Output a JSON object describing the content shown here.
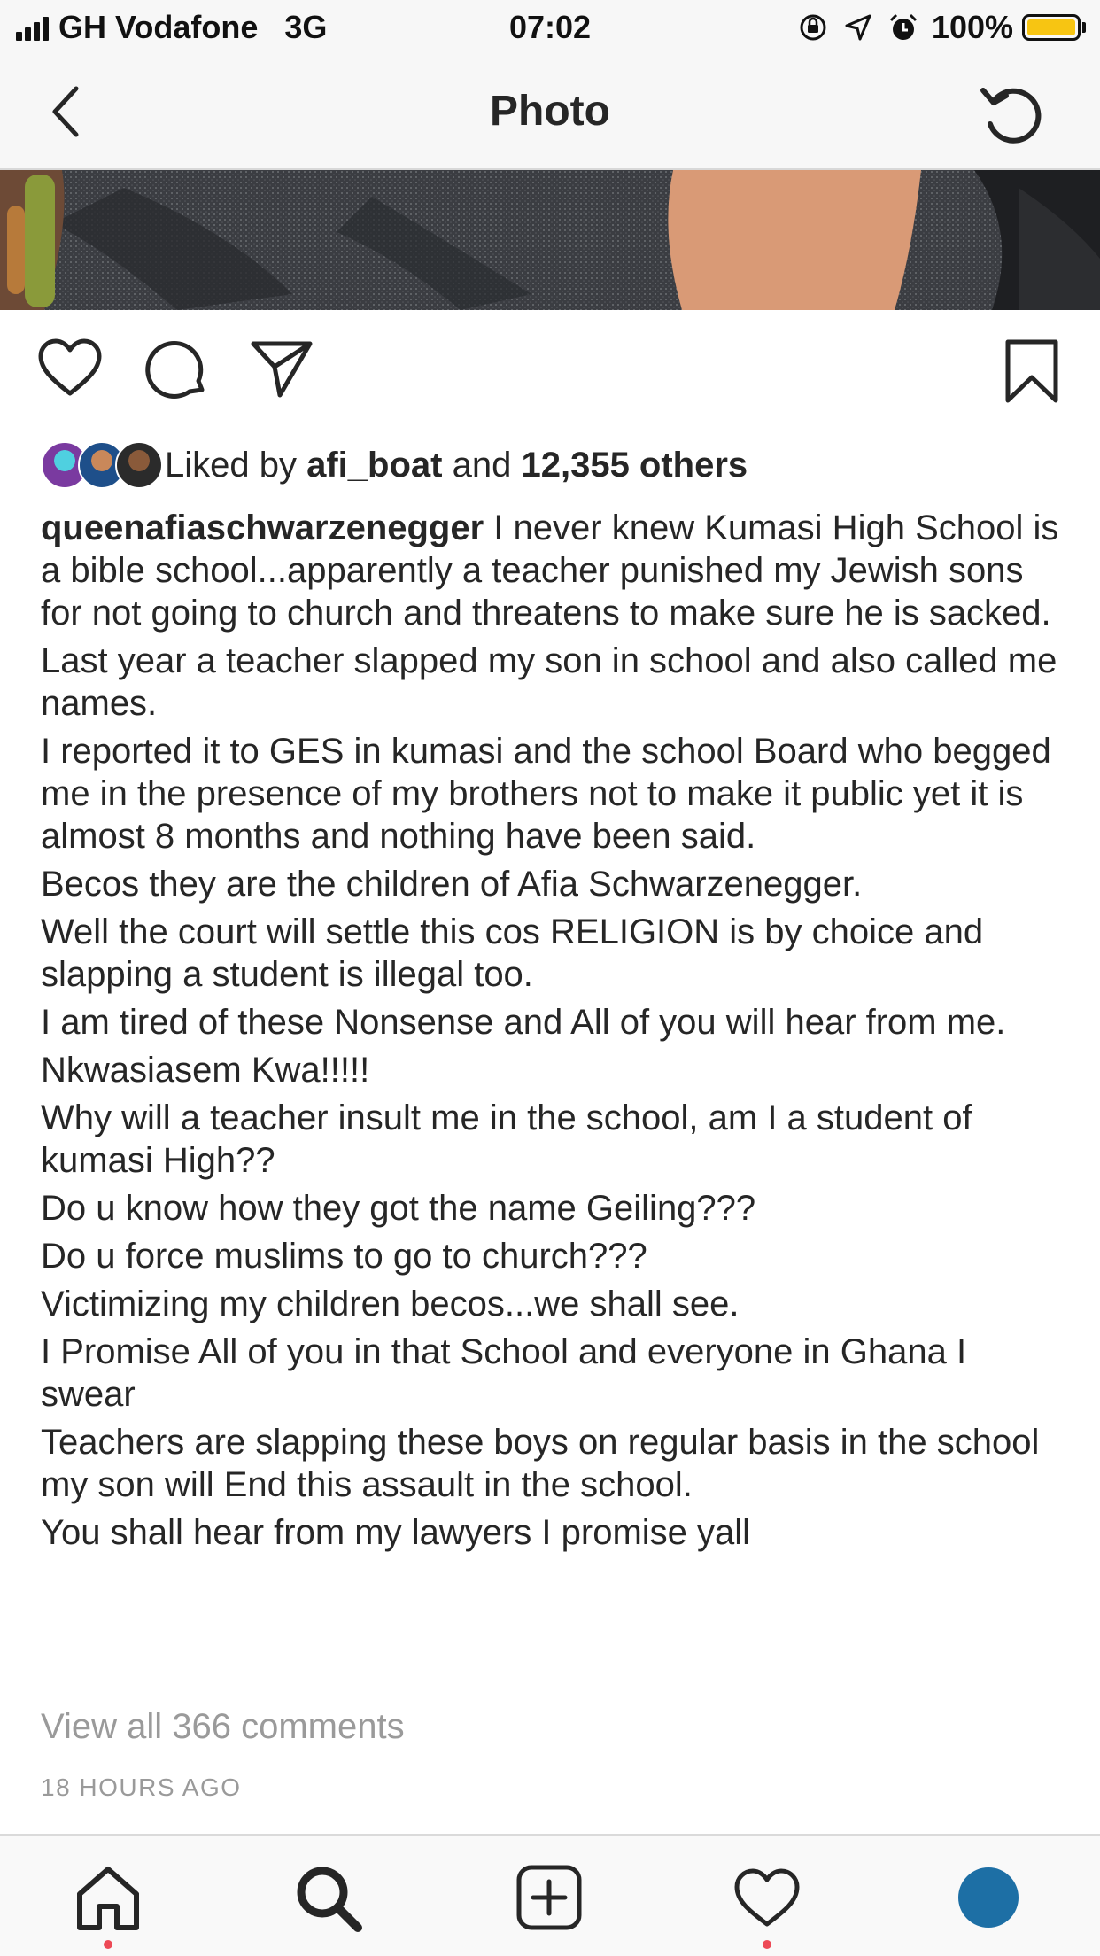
{
  "status_bar": {
    "carrier": "GH Vodafone",
    "network": "3G",
    "time": "07:02",
    "battery": "100%",
    "battery_color": "#f7c512"
  },
  "nav": {
    "title": "Photo",
    "back_icon": "chevron-left-icon",
    "refresh_icon": "refresh-icon"
  },
  "actions": {
    "icons": [
      "heart-icon",
      "comment-icon",
      "share-icon",
      "bookmark-icon"
    ]
  },
  "likes": {
    "prefix": "Liked by",
    "user": "afi_boat",
    "joiner": "and",
    "others": "12,355 others"
  },
  "caption": {
    "username": "queenafiaschwarzenegger",
    "paragraphs": [
      " I never knew Kumasi High School is a bible school...apparently a teacher punished my Jewish sons for not going to church and threatens to make sure he is sacked.",
      "Last year a teacher slapped my son in school and also called me names.",
      "I reported it to GES in kumasi and the school Board who begged me in the presence of my brothers  not to make it public yet it is almost 8 months and nothing have been said.",
      "Becos they are the children of Afia Schwarzenegger.",
      "Well the court will settle this  cos  RELIGION is by choice and slapping a student is illegal too.",
      "I am tired of these Nonsense and All of you will hear from me.",
      "Nkwasiasem Kwa!!!!!",
      "Why will a teacher insult me in the school, am I a student of kumasi High??",
      "Do u know how they got the name Geiling???",
      "Do u force muslims to go to church???",
      "Victimizing my children becos...we shall see.",
      "I Promise All of you in that School and everyone in Ghana I swear",
      "Teachers are slapping these boys on regular basis in the school my son will End this assault in the school.",
      "You shall hear from my lawyers I promise yall"
    ]
  },
  "comments": {
    "view_all": "View all 366 comments"
  },
  "timestamp": "18 HOURS AGO",
  "tab_bar": {
    "items": [
      "home-icon",
      "search-icon",
      "add-post-icon",
      "activity-icon",
      "profile-icon"
    ],
    "notification_color": "#ed4956",
    "profile_color": "#1d6fa5"
  }
}
